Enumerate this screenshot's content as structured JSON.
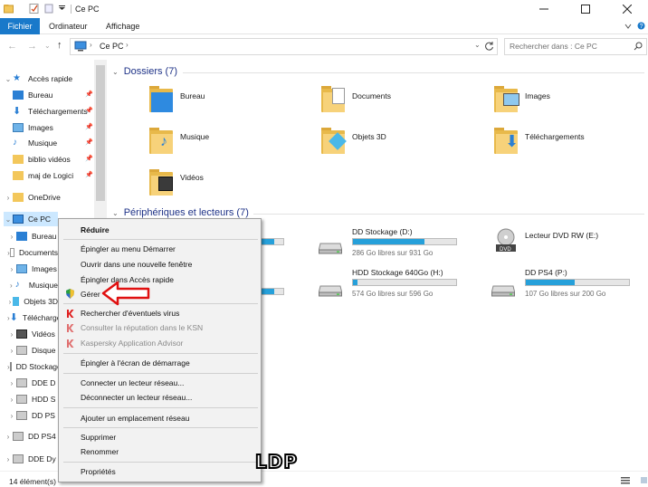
{
  "window": {
    "title": "Ce PC"
  },
  "ribbon": {
    "tabs": [
      "Fichier",
      "Ordinateur",
      "Affichage"
    ]
  },
  "address": {
    "location": "Ce PC",
    "search_placeholder": "Rechercher dans : Ce PC"
  },
  "sidebar": {
    "items": [
      {
        "label": "Accès rapide",
        "icon": "star-icon",
        "pinned": false
      },
      {
        "label": "Bureau",
        "icon": "desktop-folder-icon",
        "pinned": true
      },
      {
        "label": "Téléchargements",
        "icon": "download-folder-icon",
        "pinned": true
      },
      {
        "label": "Images",
        "icon": "pictures-folder-icon",
        "pinned": true
      },
      {
        "label": "Musique",
        "icon": "music-folder-icon",
        "pinned": true
      },
      {
        "label": "biblio vidéos",
        "icon": "folder-icon",
        "pinned": true
      },
      {
        "label": "maj de Logici",
        "icon": "folder-icon",
        "pinned": true
      },
      {
        "label": "OneDrive",
        "icon": "cloud-folder-icon",
        "pinned": false
      },
      {
        "label": "Ce PC",
        "icon": "computer-icon",
        "pinned": false
      },
      {
        "label": "Bureau",
        "icon": "desktop-folder-icon"
      },
      {
        "label": "Documents",
        "icon": "documents-folder-icon"
      },
      {
        "label": "Images",
        "icon": "pictures-folder-icon"
      },
      {
        "label": "Musique",
        "icon": "music-folder-icon"
      },
      {
        "label": "Objets 3D",
        "icon": "objects3d-folder-icon"
      },
      {
        "label": "Téléchargements",
        "icon": "download-folder-icon"
      },
      {
        "label": "Vidéos",
        "icon": "videos-folder-icon"
      },
      {
        "label": "Disque",
        "icon": "drive-icon"
      },
      {
        "label": "DD Stockage",
        "icon": "drive-icon"
      },
      {
        "label": "DDE D",
        "icon": "drive-icon"
      },
      {
        "label": "HDD S",
        "icon": "drive-icon"
      },
      {
        "label": "DD PS",
        "icon": "drive-icon"
      },
      {
        "label": "DD PS4",
        "icon": "drive-icon"
      },
      {
        "label": "DDE Dy",
        "icon": "drive-icon"
      }
    ]
  },
  "content": {
    "folders_header": "Dossiers (7)",
    "folders": [
      {
        "label": "Bureau",
        "icon": "desktop-folder-icon"
      },
      {
        "label": "Documents",
        "icon": "documents-folder-icon"
      },
      {
        "label": "Images",
        "icon": "pictures-folder-icon"
      },
      {
        "label": "Musique",
        "icon": "music-folder-icon"
      },
      {
        "label": "Objets 3D",
        "icon": "objects3d-folder-icon"
      },
      {
        "label": "Téléchargements",
        "icon": "download-folder-icon"
      },
      {
        "label": "Vidéos",
        "icon": "videos-folder-icon"
      }
    ],
    "devices_header": "Périphériques et lecteurs (7)",
    "devices": [
      {
        "label": "DD Stockage (D:)",
        "free": "286 Go libres sur 931 Go",
        "used_fraction": 0.69,
        "icon": "hard-drive-icon"
      },
      {
        "label": "Lecteur DVD RW (E:)",
        "free": "",
        "used_fraction": null,
        "icon": "dvd-drive-icon"
      },
      {
        "label": "HDD Stockage 640Go (H:)",
        "free": "574 Go libres sur 596 Go",
        "used_fraction": 0.04,
        "icon": "hard-drive-icon"
      },
      {
        "label": "DD PS4 (P:)",
        "free": "107 Go libres sur 200 Go",
        "used_fraction": 0.47,
        "icon": "hard-drive-icon"
      }
    ]
  },
  "context_menu": {
    "items": [
      {
        "label": "Réduire",
        "bold": true
      },
      {
        "label": "Épingler au menu Démarrer"
      },
      {
        "label": "Ouvrir dans une nouvelle fenêtre"
      },
      {
        "label": "Épingler dans Accès rapide"
      },
      {
        "label": "Gérer",
        "icon": "uac-shield-icon"
      },
      {
        "label": "Rechercher d'éventuels virus",
        "icon": "kaspersky-icon"
      },
      {
        "label": "Consulter la réputation dans le KSN",
        "icon": "kaspersky-icon",
        "disabled": true
      },
      {
        "label": "Kaspersky Application Advisor",
        "icon": "kaspersky-icon",
        "disabled": true
      },
      {
        "label": "Épingler à l'écran de démarrage"
      },
      {
        "label": "Connecter un lecteur réseau..."
      },
      {
        "label": "Déconnecter un lecteur réseau..."
      },
      {
        "label": "Ajouter un emplacement réseau"
      },
      {
        "label": "Supprimer"
      },
      {
        "label": "Renommer"
      },
      {
        "label": "Propriétés"
      }
    ]
  },
  "status": {
    "text": "14 élément(s)"
  },
  "watermark": "LDP",
  "colors": {
    "accent": "#1979ca",
    "selection": "#cce8ff",
    "bar_fill": "#26a0da",
    "arrow": "#e01010"
  }
}
